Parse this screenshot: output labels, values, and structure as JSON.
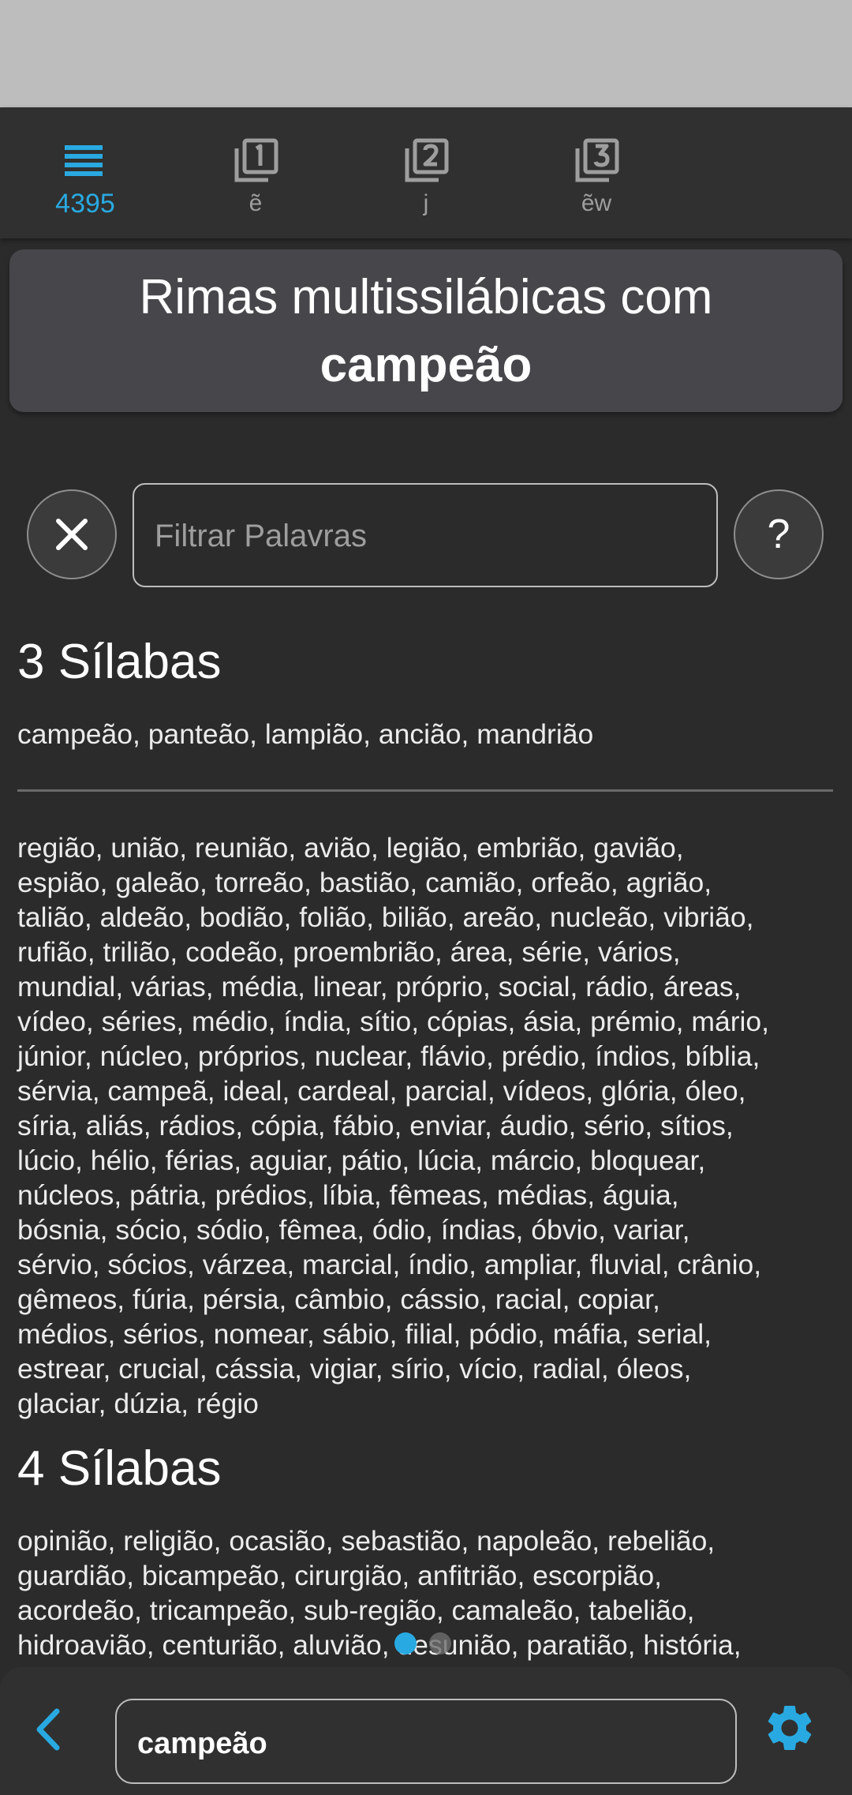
{
  "tabs": [
    {
      "label": "4395",
      "icon": "list-icon",
      "active": true
    },
    {
      "label": "ẽ",
      "icon": "filter-1-icon",
      "active": false
    },
    {
      "label": "j",
      "icon": "filter-2-icon",
      "active": false
    },
    {
      "label": "ẽw",
      "icon": "filter-3-icon",
      "active": false
    }
  ],
  "title": {
    "line1": "Rimas multissilábicas com",
    "word": "campeão"
  },
  "filter": {
    "placeholder": "Filtrar Palavras",
    "clear_icon": "close-icon",
    "help_label": "?"
  },
  "sections": [
    {
      "heading": "3 Sílabas",
      "top_words": "campeão, panteão, lampião, ancião, mandrião",
      "more_lines": [
        "região, união, reunião, avião, legião, embrião, gavião,",
        "espião, galeão, torreão, bastião, camião, orfeão, agrião,",
        "talião, aldeão, bodião, folião, bilião, areão, nucleão, vibrião,",
        "rufião, trilião, codeão, proembrião, área, série, vários,",
        "mundial, várias, média, linear, próprio, social, rádio, áreas,",
        "vídeo, séries, médio, índia, sítio, cópias, ásia, prémio, mário,",
        "júnior, núcleo, próprios, nuclear, flávio, prédio, índios, bíblia,",
        "sérvia, campeã, ideal, cardeal, parcial, vídeos, glória, óleo,",
        "síria, aliás, rádios, cópia, fábio, enviar, áudio, sério, sítios,",
        "lúcio, hélio, férias, aguiar, pátio, lúcia, márcio, bloquear,",
        "núcleos, pátria, prédios, líbia, fêmeas, médias, águia,",
        "bósnia, sócio, sódio, fêmea, ódio, índias, óbvio, variar,",
        "sérvio, sócios, várzea, marcial, índio, ampliar, fluvial, crânio,",
        "gêmeos, fúria, pérsia, câmbio, cássio, racial, copiar,",
        "médios, sérios, nomear, sábio, filial, pódio, máfia, serial,",
        "estrear, crucial, cássia, vigiar, sírio, vício, radial, óleos,",
        "glaciar, dúzia, régio"
      ]
    },
    {
      "heading": "4 Sílabas",
      "lines": [
        "opinião, religião, ocasião, sebastião, napoleão, rebelião,",
        "guardião, bicampeão, cirurgião, anfitrião, escorpião,",
        "acordeão, tricampeão, sub-região, camaleão, tabelião,",
        "hidroavião, centurião, aluvião, desunião, paratião, história,"
      ]
    }
  ],
  "bottom": {
    "back_icon": "back-arrow-icon",
    "search_value": "campeão",
    "settings_icon": "gear-icon"
  },
  "colors": {
    "accent": "#29a9e1",
    "background": "#2b2b2b",
    "card": "#47474b"
  }
}
